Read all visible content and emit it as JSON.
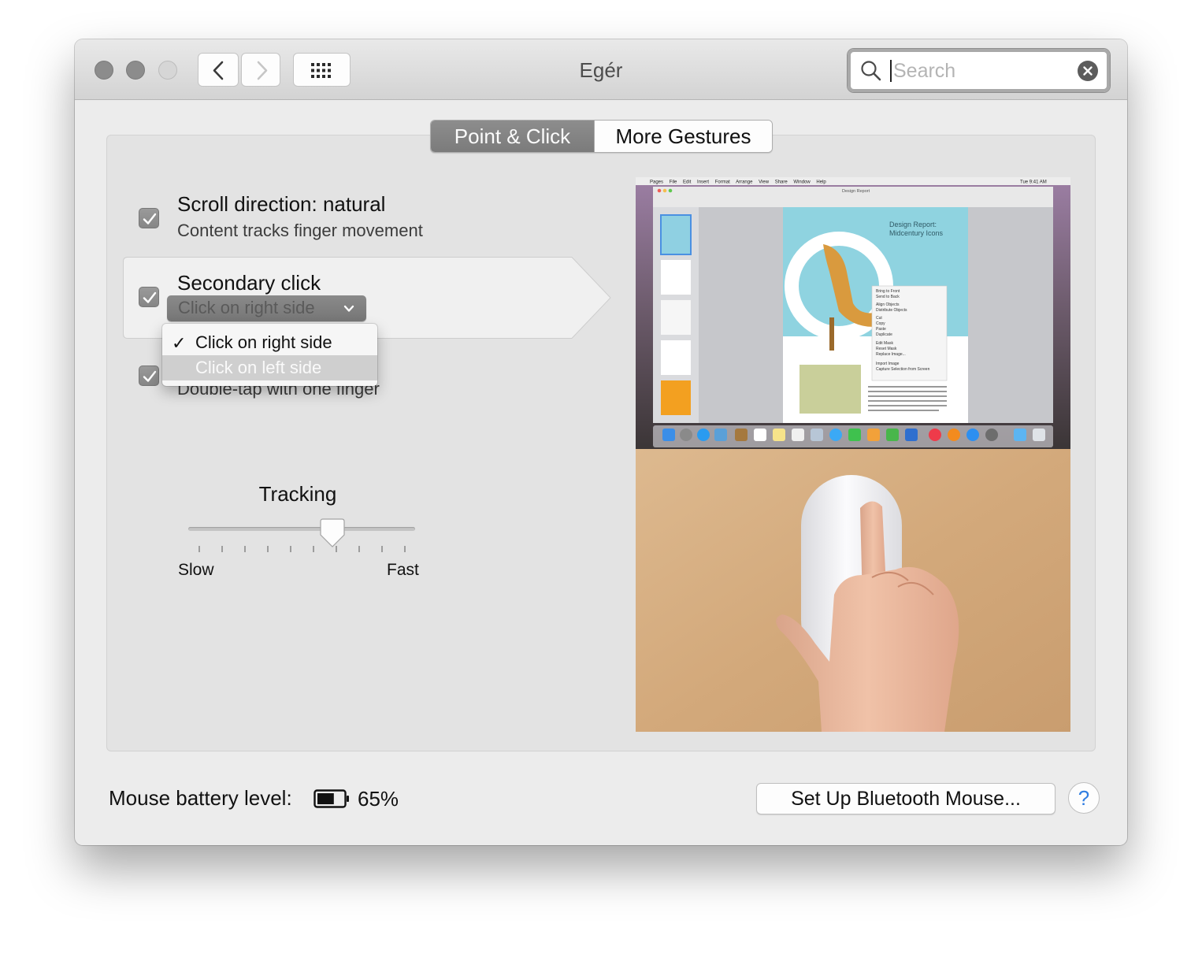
{
  "window": {
    "title": "Egér"
  },
  "search": {
    "placeholder": "Search",
    "value": ""
  },
  "tabs": [
    {
      "label": "Point & Click",
      "selected": true
    },
    {
      "label": "More Gestures",
      "selected": false
    }
  ],
  "options": {
    "scroll": {
      "title": "Scroll direction: natural",
      "subtitle": "Content tracks finger movement",
      "checked": true
    },
    "secondary": {
      "title": "Secondary click",
      "popup_value": "Click on right side",
      "checked": true
    },
    "smart_zoom": {
      "subtitle": "Double-tap with one finger",
      "checked": true
    }
  },
  "dropdown": {
    "items": [
      {
        "label": "Click on right side",
        "checked": true,
        "check_mark": "✓"
      },
      {
        "label": "Click on left side",
        "checked": false,
        "hovered": true
      }
    ]
  },
  "tracking": {
    "label": "Tracking",
    "min_label": "Slow",
    "max_label": "Fast",
    "tick_count": 10,
    "value_fraction": 0.65
  },
  "footer": {
    "battery_label": "Mouse battery level:",
    "battery_percent": "65%",
    "bluetooth_button": "Set Up Bluetooth Mouse...",
    "help": "?"
  },
  "preview_screen": {
    "menubar": [
      "Pages",
      "File",
      "Edit",
      "Insert",
      "Format",
      "Arrange",
      "View",
      "Share",
      "Window",
      "Help"
    ],
    "menubar_clock": "Tue 9:41 AM",
    "doc_title": "Design Report",
    "doc_heading_line1": "Design Report:",
    "doc_heading_line2": "Midcentury Icons",
    "context_menu": [
      "Bring to Front",
      "Send to Back",
      "Align Objects",
      "Distribute Objects",
      "Cut",
      "Copy",
      "Paste",
      "Duplicate",
      "Edit Mask",
      "Reset Mask",
      "Replace Image...",
      "Import Image",
      "Capture Selection from Screen"
    ]
  },
  "colors": {
    "accent_blue": "#2f7de1",
    "selected_segment": "#848484",
    "checkbox": "#8e8e8e"
  }
}
